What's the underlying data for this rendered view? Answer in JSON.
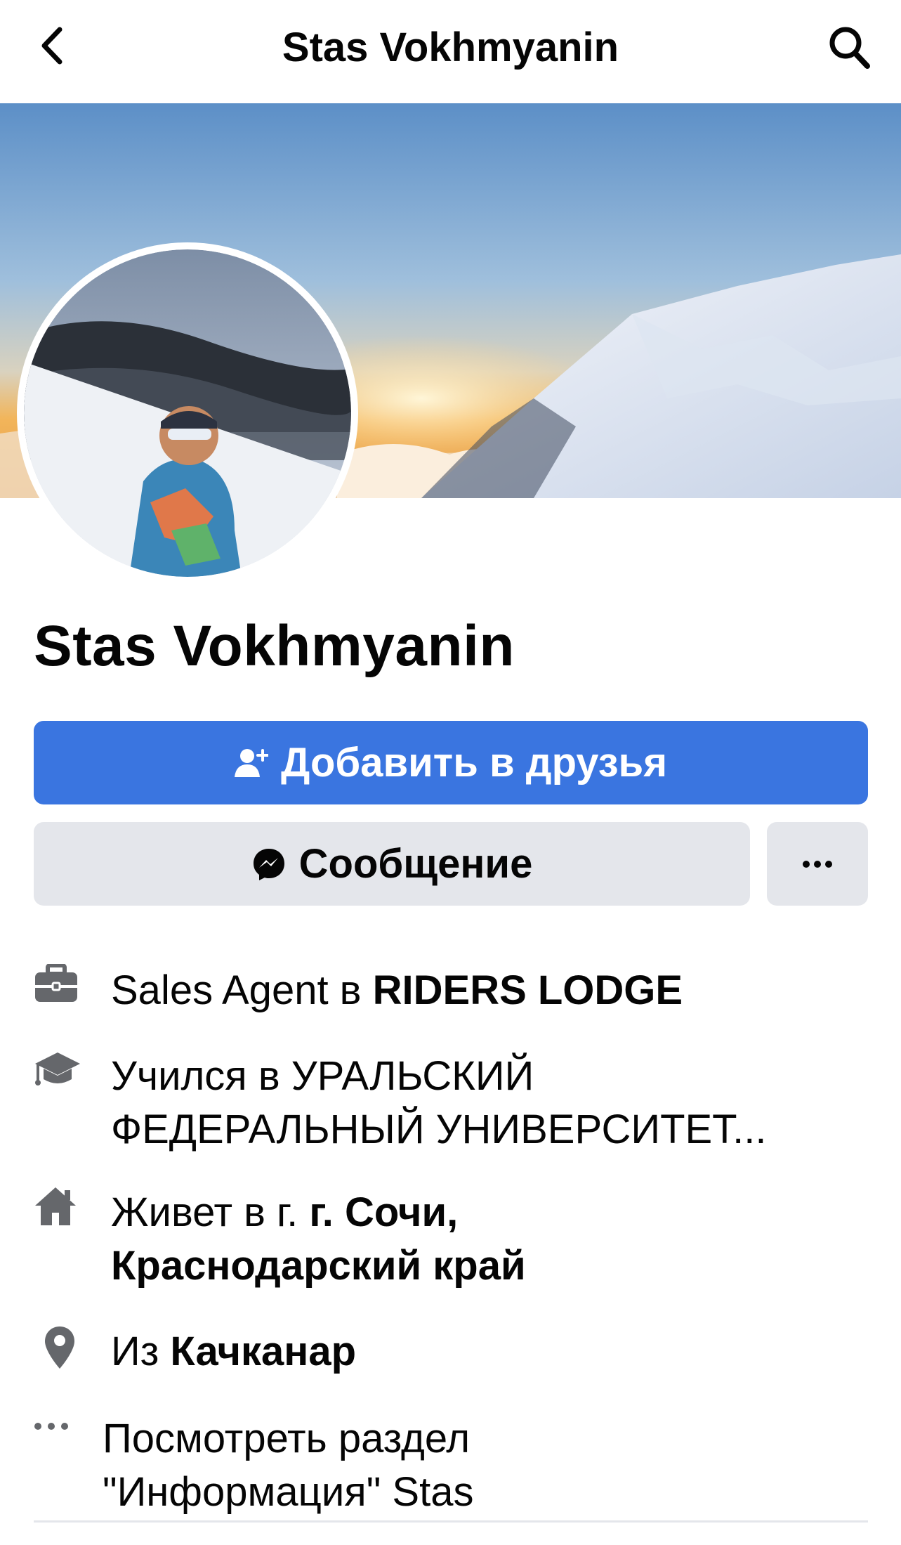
{
  "header": {
    "title": "Stas Vokhmyanin",
    "back_icon": "chevron-left-icon",
    "search_icon": "search-icon"
  },
  "profile": {
    "name": "Stas Vokhmyanin"
  },
  "actions": {
    "add_friend_label": "Добавить в друзья",
    "add_friend_icon": "add-friend-icon",
    "message_label": "Сообщение",
    "message_icon": "messenger-icon",
    "more_icon": "more-icon"
  },
  "info": {
    "work_prefix": "Sales Agent в ",
    "work_place": "RIDERS LODGE",
    "study_line1": "Учился в УРАЛЬСКИЙ",
    "study_line2": "ФЕДЕРАЛЬНЫЙ УНИВЕРСИТЕТ...",
    "lives_prefix": "Живет в г. ",
    "lives_place_line1": "г. Сочи,",
    "lives_place_line2": "Краснодарский край",
    "from_prefix": "Из ",
    "from_place": "Качканар",
    "see_about_line1": "Посмотреть раздел",
    "see_about_line2": "\"Информация\" Stas"
  },
  "colors": {
    "primary_button": "#3a75e0",
    "secondary_button": "#e4e6eb",
    "text": "#050505",
    "icon_gray": "#65676b"
  }
}
